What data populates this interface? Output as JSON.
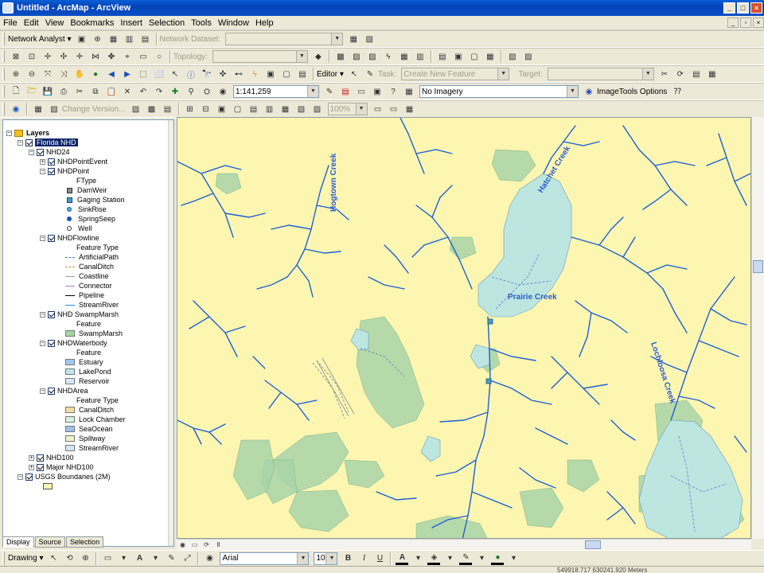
{
  "window": {
    "title": "Untitled - ArcMap - ArcView"
  },
  "menu": [
    "File",
    "Edit",
    "View",
    "Bookmarks",
    "Insert",
    "Selection",
    "Tools",
    "Window",
    "Help"
  ],
  "toolbars": {
    "network_analyst": {
      "label": "Network Analyst ▾",
      "dataset_label": "Network Dataset:"
    },
    "topology": {
      "label": "Topology:"
    },
    "editor": {
      "label": "Editor ▾",
      "task_label": "Task:",
      "task_value": "Create New Feature",
      "target_label": "Target:"
    },
    "standard": {
      "scale": "1:141,259",
      "imagery_value": "No Imagery",
      "imagetools_label": "ImageTools Options"
    },
    "versioning": {
      "change_version": "Change Version...",
      "zoom_value": "100%"
    }
  },
  "toc": {
    "root": "Layers",
    "tabs": [
      "Display",
      "Source",
      "Selection"
    ],
    "items": [
      {
        "label": "Florida NHD",
        "selected": true
      },
      {
        "label": "NHD24"
      },
      {
        "label": "NHDPointEvent"
      },
      {
        "label": "NHDPoint"
      },
      {
        "label": "FType"
      },
      {
        "label": "DamWeir"
      },
      {
        "label": "Gaging Station"
      },
      {
        "label": "SinkRise"
      },
      {
        "label": "SpringSeep"
      },
      {
        "label": "Well"
      },
      {
        "label": "NHDFlowline"
      },
      {
        "label": "Feature Type"
      },
      {
        "label": "ArtificialPath"
      },
      {
        "label": "CanalDitch"
      },
      {
        "label": "Coastline"
      },
      {
        "label": "Connector"
      },
      {
        "label": "Pipeline"
      },
      {
        "label": "StreamRiver"
      },
      {
        "label": "NHD SwampMarsh"
      },
      {
        "label": "Feature"
      },
      {
        "label": "SwampMarsh"
      },
      {
        "label": "NHDWaterbody"
      },
      {
        "label": "Feature"
      },
      {
        "label": "Estuary"
      },
      {
        "label": "LakePond"
      },
      {
        "label": "Reservoir"
      },
      {
        "label": "NHDArea"
      },
      {
        "label": "Feature Type"
      },
      {
        "label": "CanalDitch"
      },
      {
        "label": "Lock Chamber"
      },
      {
        "label": "SeaOcean"
      },
      {
        "label": "Spillway"
      },
      {
        "label": "StreamRiver"
      },
      {
        "label": "NHD100"
      },
      {
        "label": "Major NHD100"
      },
      {
        "label": "USGS Boundaries (2M)"
      }
    ]
  },
  "map": {
    "labels": [
      "Hogtown Creek",
      "Hatchet Creek",
      "Prairie Creek",
      "Lochloosa Creek"
    ],
    "colors": {
      "land": "#fdf6b0",
      "water": "#bde6e0",
      "swamp": "#a8d3a8",
      "stream": "#1e5fd8"
    }
  },
  "drawbar": {
    "drawing": "Drawing ▾",
    "font": "Arial",
    "size": "10"
  },
  "status": {
    "coords": "549918.717  630241.920 Meters"
  }
}
